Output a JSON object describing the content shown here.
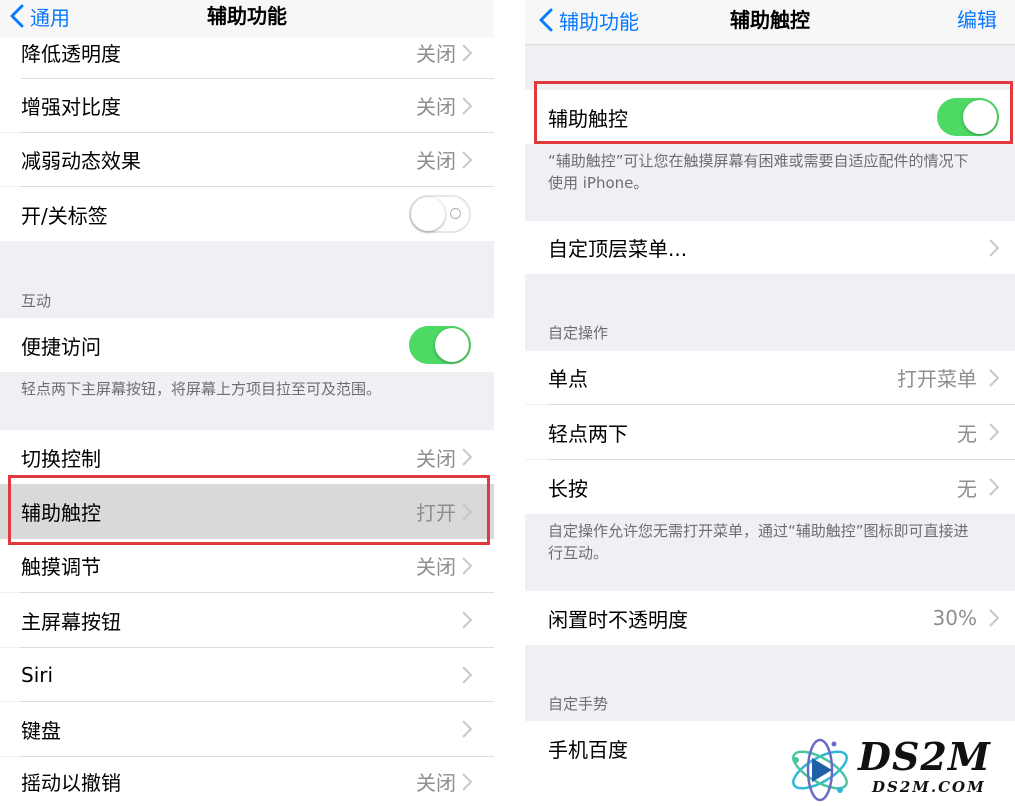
{
  "left": {
    "nav": {
      "back_label": "通用",
      "title": "辅助功能"
    },
    "rows": [
      {
        "label": "降低透明度",
        "value": "关闭"
      },
      {
        "label": "增强对比度",
        "value": "关闭"
      },
      {
        "label": "减弱动态效果",
        "value": "关闭"
      },
      {
        "label": "开/关标签"
      }
    ],
    "interaction": {
      "header": "互动",
      "reachability_label": "便捷访问",
      "reachability_footer": "轻点两下主屏幕按钮，将屏幕上方项目拉至可及范围。"
    },
    "rows2": [
      {
        "label": "切换控制",
        "value": "关闭"
      },
      {
        "label": "辅助触控",
        "value": "打开"
      },
      {
        "label": "触摸调节",
        "value": "关闭"
      },
      {
        "label": "主屏幕按钮"
      },
      {
        "label": "Siri"
      },
      {
        "label": "键盘"
      },
      {
        "label": "摇动以撤销",
        "value": "关闭"
      }
    ],
    "switches": {
      "labels_on": false,
      "reachability_on": true
    }
  },
  "right": {
    "nav": {
      "back_label": "辅助功能",
      "title": "辅助触控",
      "edit_label": "编辑"
    },
    "assistive_touch": {
      "label": "辅助触控",
      "on": true,
      "footer_line1": "“辅助触控”可让您在触摸屏幕有困难或需要自适应配件的情况下",
      "footer_line2": "使用 iPhone。"
    },
    "top_menu_label": "自定顶层菜单...",
    "custom_actions": {
      "header": "自定操作",
      "items": [
        {
          "label": "单点",
          "value": "打开菜单"
        },
        {
          "label": "轻点两下",
          "value": "无"
        },
        {
          "label": "长按",
          "value": "无"
        }
      ],
      "footer_line1": "自定操作允许您无需打开菜单，通过“辅助触控”图标即可直接进",
      "footer_line2": "行互动。"
    },
    "idle_opacity": {
      "label": "闲置时不透明度",
      "value": "30%"
    },
    "custom_gestures": {
      "header": "自定手势",
      "item": "手机百度"
    }
  },
  "watermark": {
    "brand": "DS2M",
    "url": "DS2M.COM"
  },
  "colors": {
    "accent": "#0a7aff",
    "switch_on": "#4cd964",
    "highlight_box": "#e0393e",
    "group_bg": "#efeff4"
  }
}
